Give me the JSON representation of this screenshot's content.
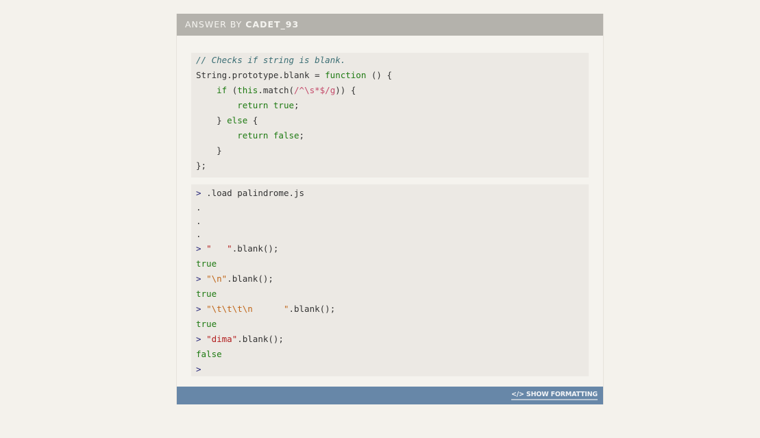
{
  "header": {
    "prefix": "ANSWER BY",
    "author": "CADET_93"
  },
  "code_block_1": {
    "lines": [
      "// Checks if string is blank.",
      "String.prototype.blank = function () {",
      "    if (this.match(/^\\s*$/g)) {",
      "        return true;",
      "    } else {",
      "        return false;",
      "    }",
      "};"
    ]
  },
  "code_block_2": {
    "prompt": ">",
    "load_cmd": ".load palindrome.js",
    "dots": [
      ".",
      ".",
      "."
    ],
    "entries": [
      {
        "string": "\"   \"",
        "call": ".blank();",
        "result": "true"
      },
      {
        "string": "\"\\n\"",
        "call": ".blank();",
        "result": "true"
      },
      {
        "string": "\"\\t\\t\\t\\n      \"",
        "call": ".blank();",
        "result": "true"
      },
      {
        "string": "\"dima\"",
        "call": ".blank();",
        "result": "false"
      }
    ]
  },
  "footer": {
    "icon": "code-icon",
    "icon_glyph": "</>",
    "label": "SHOW FORMATTING"
  }
}
